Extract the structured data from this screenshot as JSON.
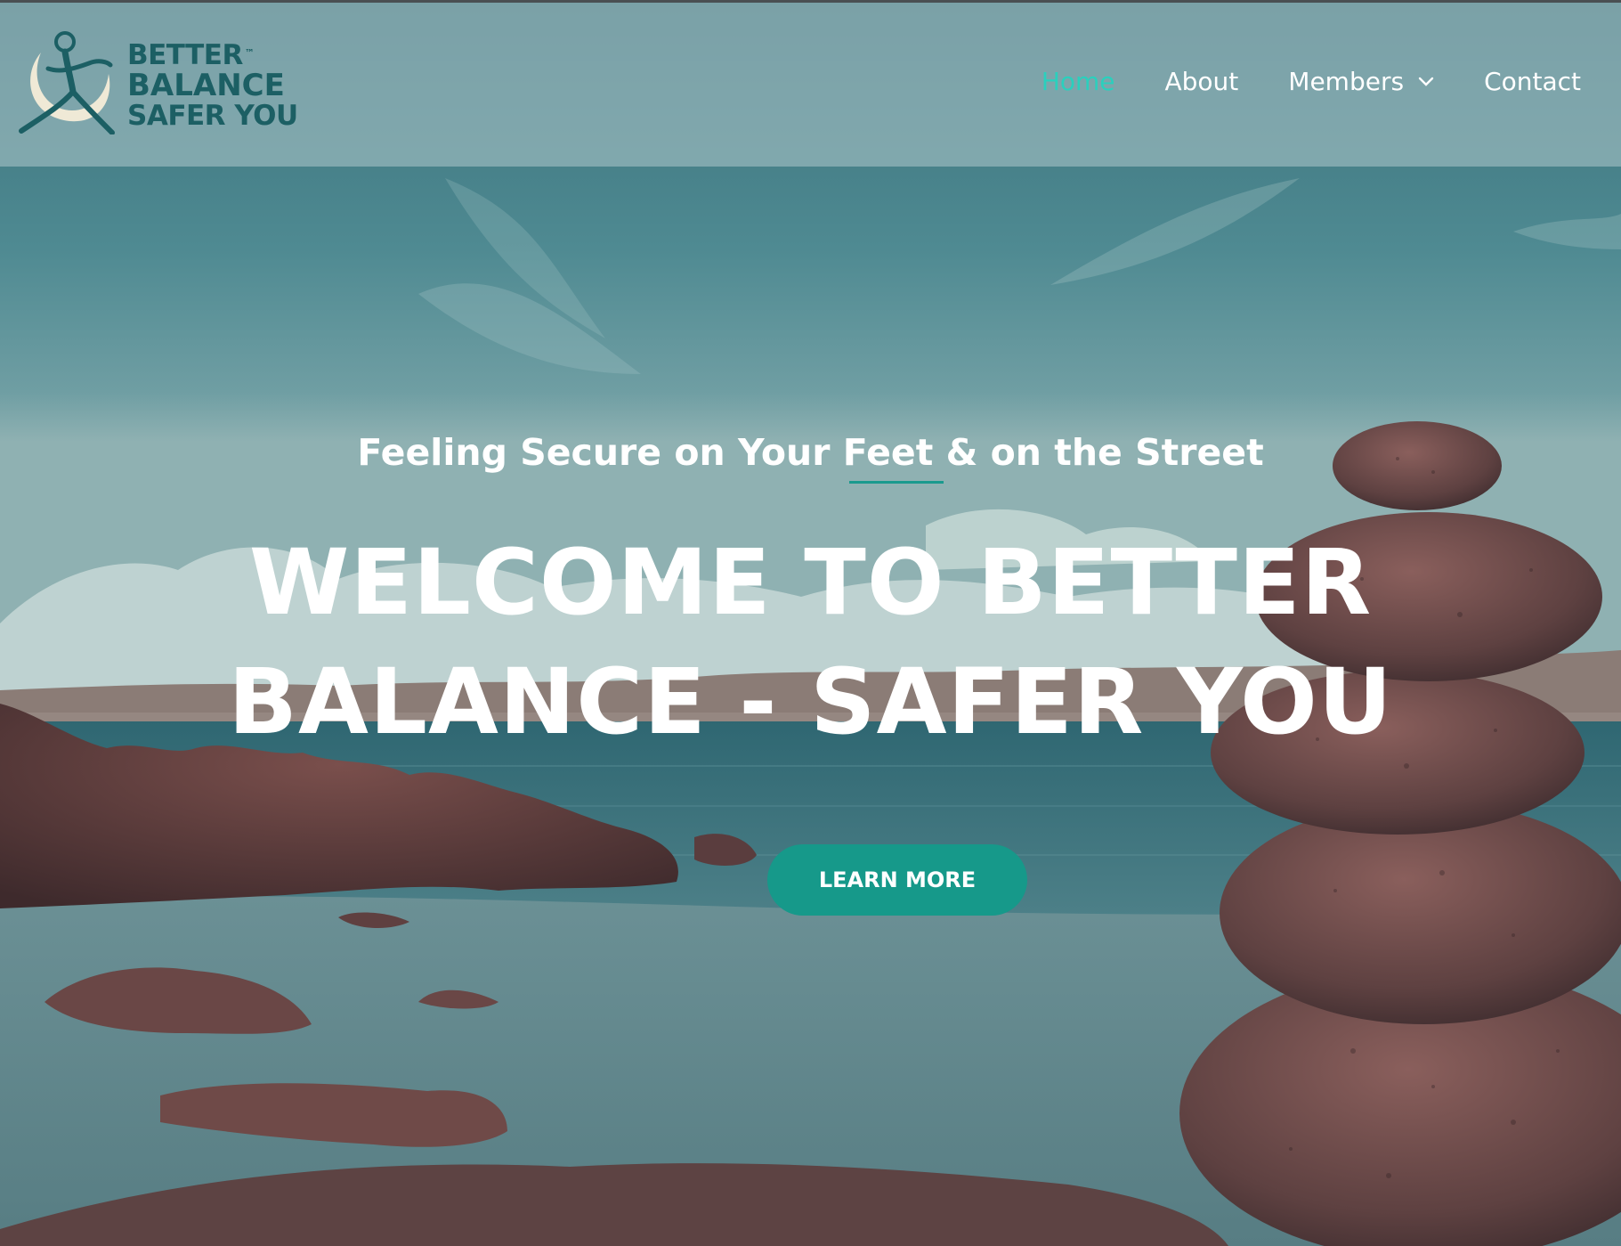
{
  "brand": {
    "line1": "BETTER",
    "tm": "™",
    "line2": "BALANCE",
    "line3": "SAFER YOU"
  },
  "nav": {
    "items": [
      {
        "label": "Home",
        "active": true
      },
      {
        "label": "About",
        "active": false
      },
      {
        "label": "Members",
        "active": false,
        "has_dropdown": true
      },
      {
        "label": "Contact",
        "active": false
      }
    ]
  },
  "hero": {
    "tagline": "Feeling Secure on Your Feet & on the Street",
    "headline_line1": "WELCOME TO BETTER",
    "headline_line2": "BALANCE - SAFER YOU",
    "cta_label": "LEARN MORE",
    "background": "beach with stacked stones"
  },
  "colors": {
    "brand_dark_teal": "#1c5f64",
    "nav_active": "#2ad0bd",
    "cta_bg": "#16998a",
    "header_overlay": "#aac4c8"
  }
}
